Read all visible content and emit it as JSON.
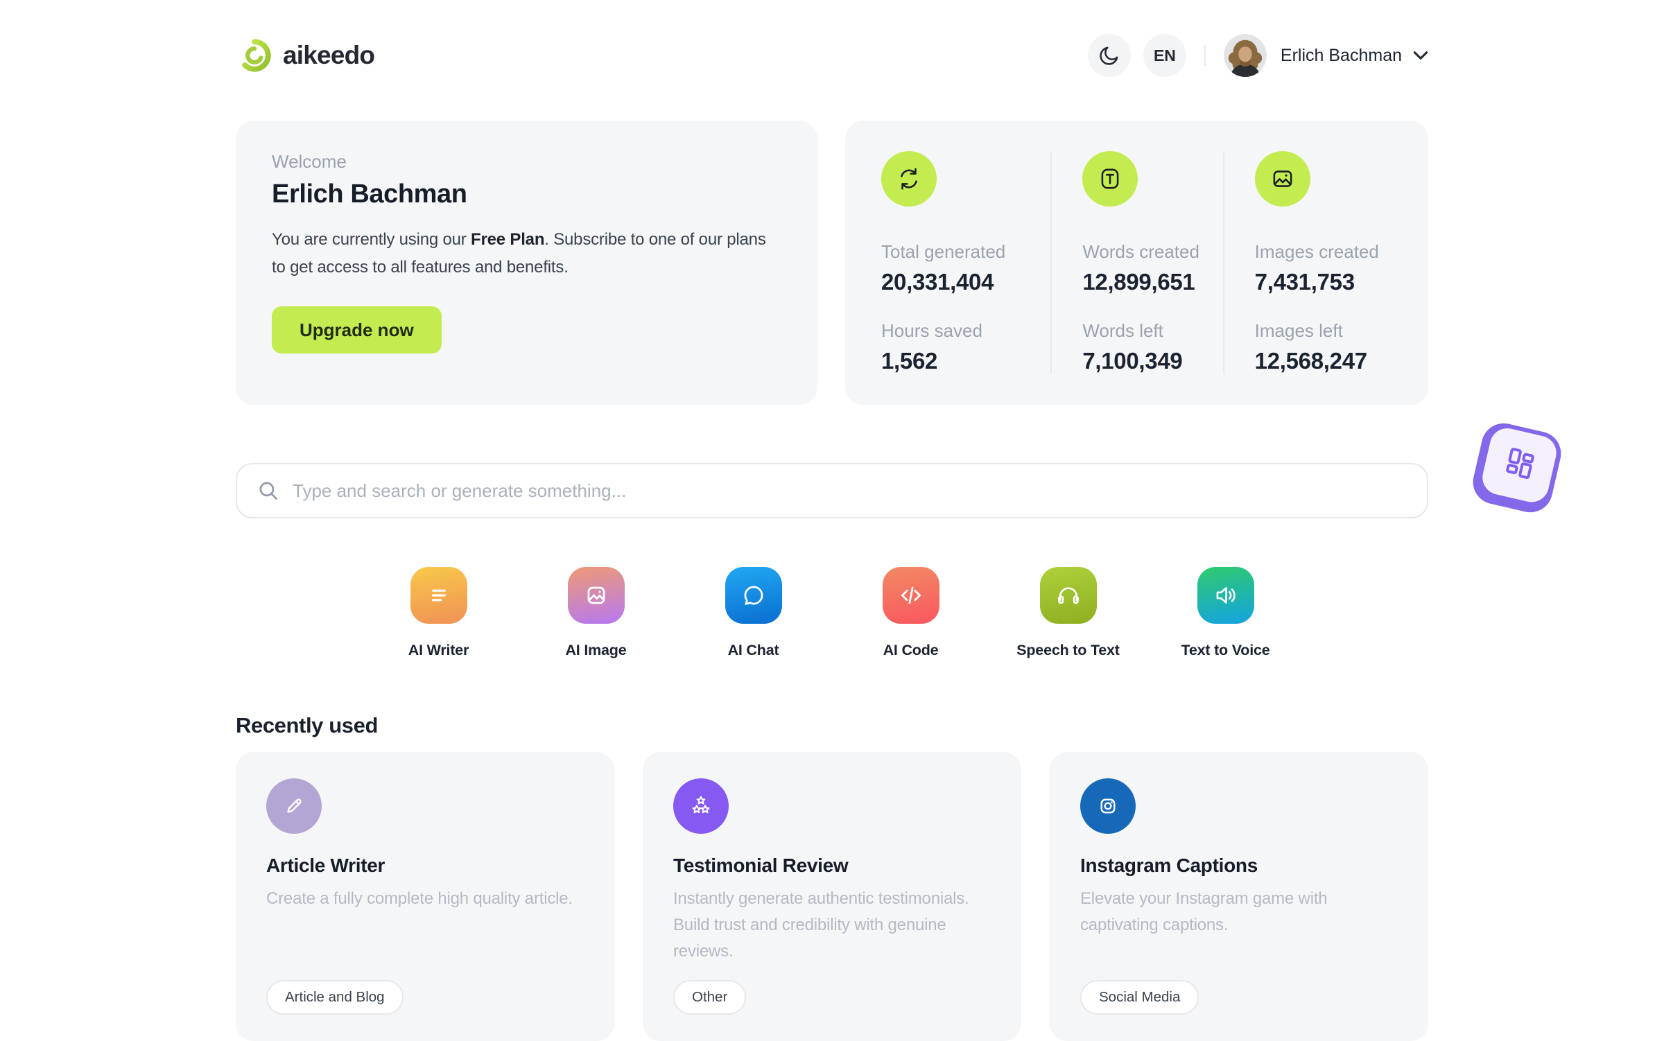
{
  "header": {
    "logo_text": "aikeedo",
    "language": "EN",
    "user_name": "Erlich Bachman"
  },
  "welcome_card": {
    "eyebrow": "Welcome",
    "name": "Erlich Bachman",
    "body_prefix": "You are currently using our ",
    "plan": "Free Plan",
    "body_suffix": ". Subscribe to one of our plans to get access to all features and benefits.",
    "cta": "Upgrade now"
  },
  "stats_card": {
    "columns": [
      {
        "icon": "sync-icon",
        "rows": [
          {
            "label": "Total generated",
            "value": "20,331,404"
          },
          {
            "label": "Hours saved",
            "value": "1,562"
          }
        ]
      },
      {
        "icon": "text-icon",
        "rows": [
          {
            "label": "Words created",
            "value": "12,899,651"
          },
          {
            "label": "Words left",
            "value": "7,100,349"
          }
        ]
      },
      {
        "icon": "image-icon",
        "rows": [
          {
            "label": "Images created",
            "value": "7,431,753"
          },
          {
            "label": "Images left",
            "value": "12,568,247"
          }
        ]
      }
    ]
  },
  "search": {
    "placeholder": "Type and search or generate something..."
  },
  "tools": [
    {
      "label": "AI Writer",
      "icon": "writer-icon",
      "gradient": [
        "#f8c94a",
        "#f09155"
      ]
    },
    {
      "label": "AI Image",
      "icon": "image-icon",
      "gradient": [
        "#ee9a74",
        "#b678f2"
      ]
    },
    {
      "label": "AI Chat",
      "icon": "chat-icon",
      "gradient": [
        "#21a8f2",
        "#0a6ed2"
      ]
    },
    {
      "label": "AI Code",
      "icon": "code-icon",
      "gradient": [
        "#f28a63",
        "#f9575f"
      ]
    },
    {
      "label": "Speech to Text",
      "icon": "headphones-icon",
      "gradient": [
        "#aed13a",
        "#8fae22"
      ]
    },
    {
      "label": "Text to Voice",
      "icon": "speaker-icon",
      "gradient": [
        "#2fcb6d",
        "#14a2e2"
      ]
    }
  ],
  "recently_used": {
    "heading": "Recently used",
    "cards": [
      {
        "title": "Article Writer",
        "description": "Create a fully complete high quality article.",
        "tag": "Article and Blog",
        "icon": "pencil-icon",
        "icon_bg": "#b3a6d4"
      },
      {
        "title": "Testimonial Review",
        "description": "Instantly generate authentic testimonials. Build trust and credibility with genuine reviews.",
        "tag": "Other",
        "icon": "stars-icon",
        "icon_bg": "#8659f2"
      },
      {
        "title": "Instagram Captions",
        "description": "Elevate your Instagram game with captivating captions.",
        "tag": "Social Media",
        "icon": "instagram-icon",
        "icon_bg": "#1569b8"
      }
    ]
  },
  "colors": {
    "accent_lime": "#c3ec51",
    "panel_gray": "#f5f6f7",
    "sticker_purple": "#8468ea",
    "text_dark": "#1b2330",
    "text_gray": "#9aa3ae"
  }
}
